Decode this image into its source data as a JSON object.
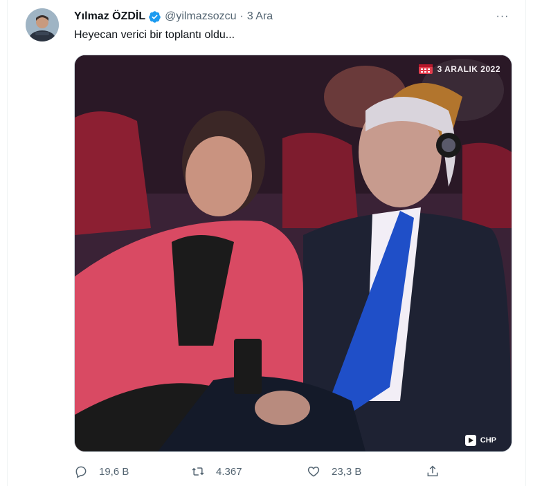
{
  "tweet": {
    "author_name": "Yılmaz ÖZDİL",
    "handle": "@yilmazsozcu",
    "separator": "·",
    "time": "3 Ara",
    "text": "Heyecan verici bir toplantı oldu...",
    "more_label": "···"
  },
  "media": {
    "date_overlay": "3 ARALIK 2022",
    "watermark": "CHP"
  },
  "actions": {
    "replies": "19,6 B",
    "retweets": "4.367",
    "likes": "23,3 B"
  },
  "icons": {
    "verified": "verified-badge-icon",
    "reply": "reply-icon",
    "retweet": "retweet-icon",
    "like": "heart-icon",
    "share": "share-icon",
    "more": "more-icon"
  },
  "colors": {
    "verified_blue": "#1d9bf0",
    "secondary_text": "#536471",
    "primary_text": "#0f1419",
    "border": "#cfd9de"
  }
}
